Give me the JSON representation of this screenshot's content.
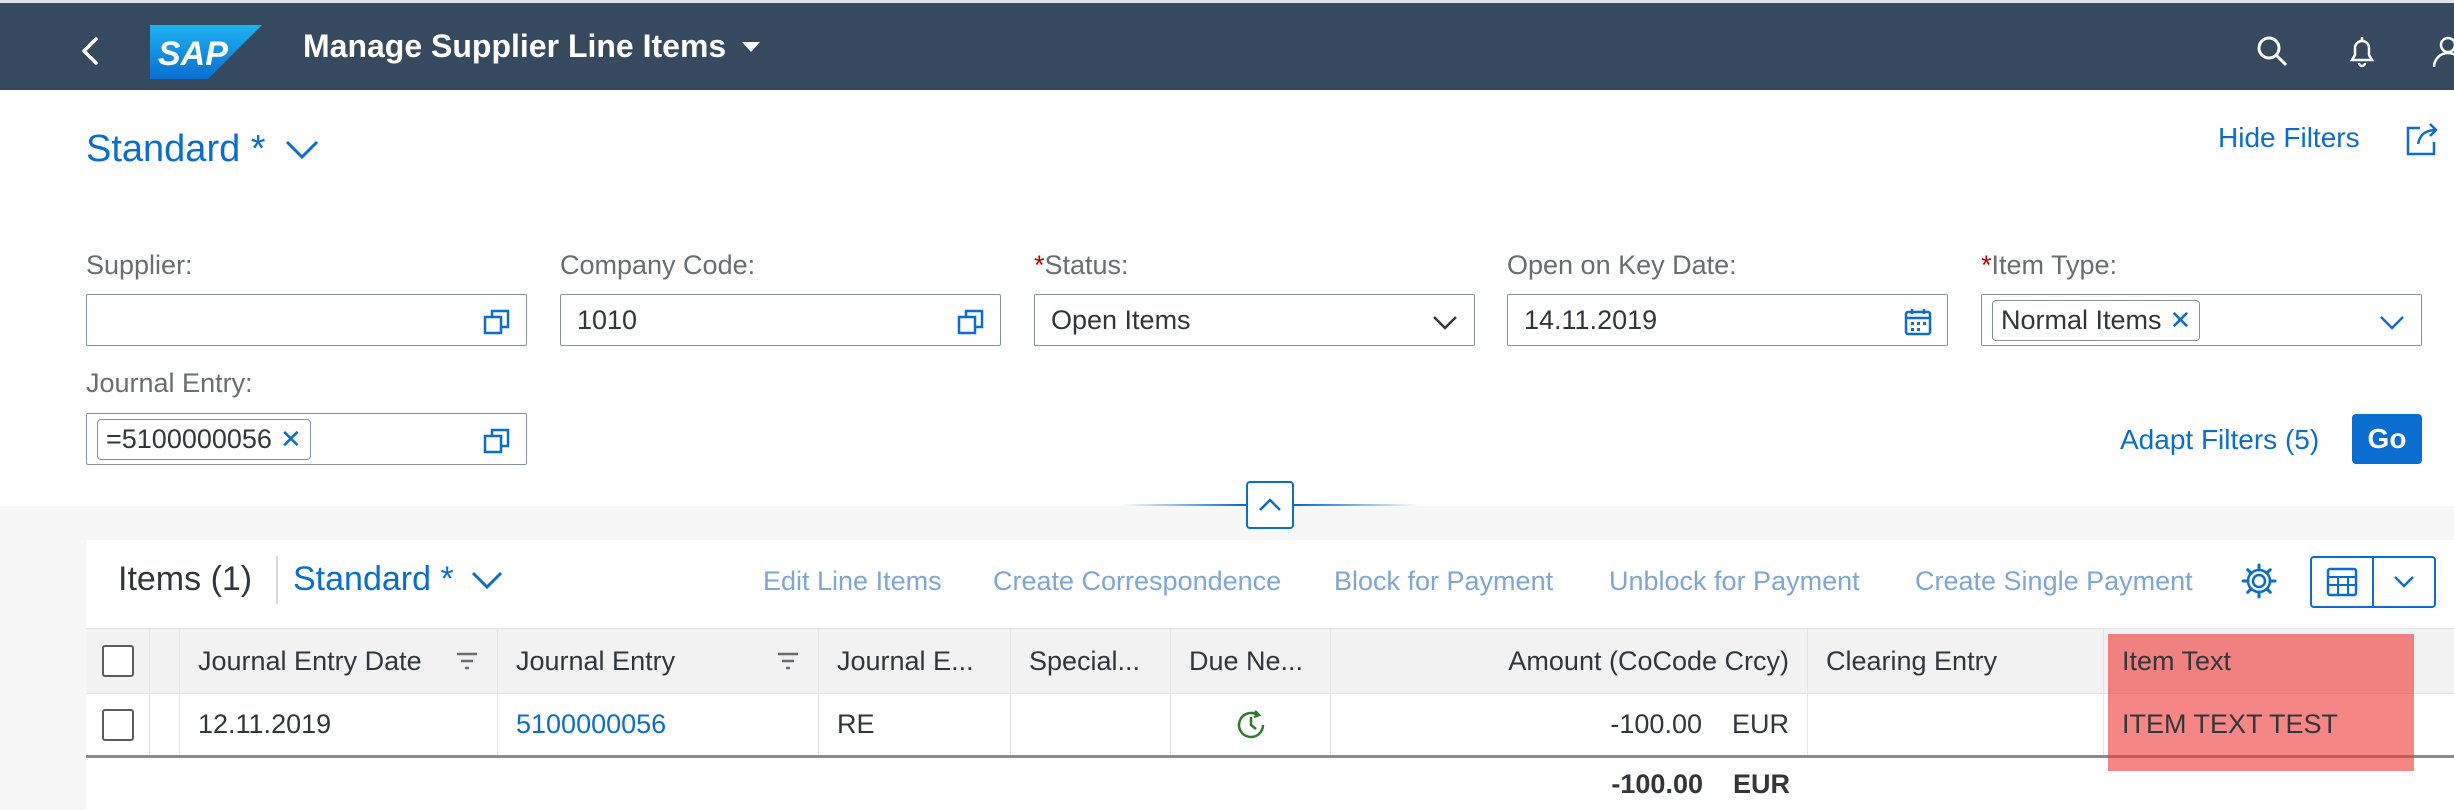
{
  "shell": {
    "logo_text": "SAP",
    "app_title": "Manage Supplier Line Items",
    "icons": [
      "back-icon",
      "search-icon",
      "notification-bell-icon",
      "user-icon"
    ]
  },
  "header": {
    "variant_name": "Standard *",
    "hide_filters": "Hide Filters"
  },
  "filters": {
    "supplier": {
      "label": "Supplier:",
      "value": ""
    },
    "company_code": {
      "label": "Company Code:",
      "value": "1010"
    },
    "status": {
      "label": "Status:",
      "required": "*",
      "value": "Open Items"
    },
    "key_date": {
      "label": "Open on Key Date:",
      "value": "14.11.2019"
    },
    "item_type": {
      "label": "Item Type:",
      "required": "*",
      "token": "Normal Items"
    },
    "journal_entry": {
      "label": "Journal Entry:",
      "token": "=5100000056"
    },
    "adapt_filters": "Adapt Filters (5)",
    "go": "Go"
  },
  "table": {
    "title": "Items (1)",
    "variant_name": "Standard *",
    "toolbar_buttons": [
      "Edit Line Items",
      "Create Correspondence",
      "Block for Payment",
      "Unblock for Payment",
      "Create Single Payment"
    ],
    "columns": [
      "Journal Entry Date",
      "Journal Entry",
      "Journal E...",
      "Special...",
      "Due Ne...",
      "Amount (CoCode Crcy)",
      "Clearing Entry",
      "Item Text"
    ],
    "rows": [
      {
        "journal_entry_date": "12.11.2019",
        "journal_entry": "5100000056",
        "journal_entry_type": "RE",
        "special": "",
        "due_status_icon": "clock-due-icon",
        "amount": "-100.00",
        "currency": "EUR",
        "clearing_entry": "",
        "item_text": "ITEM TEXT TEST"
      }
    ],
    "total": {
      "amount": "-100.00",
      "currency": "EUR"
    }
  },
  "colors": {
    "shell": "#354a5f",
    "accent": "#0a6ed1",
    "highlight": "#f03c3c"
  }
}
